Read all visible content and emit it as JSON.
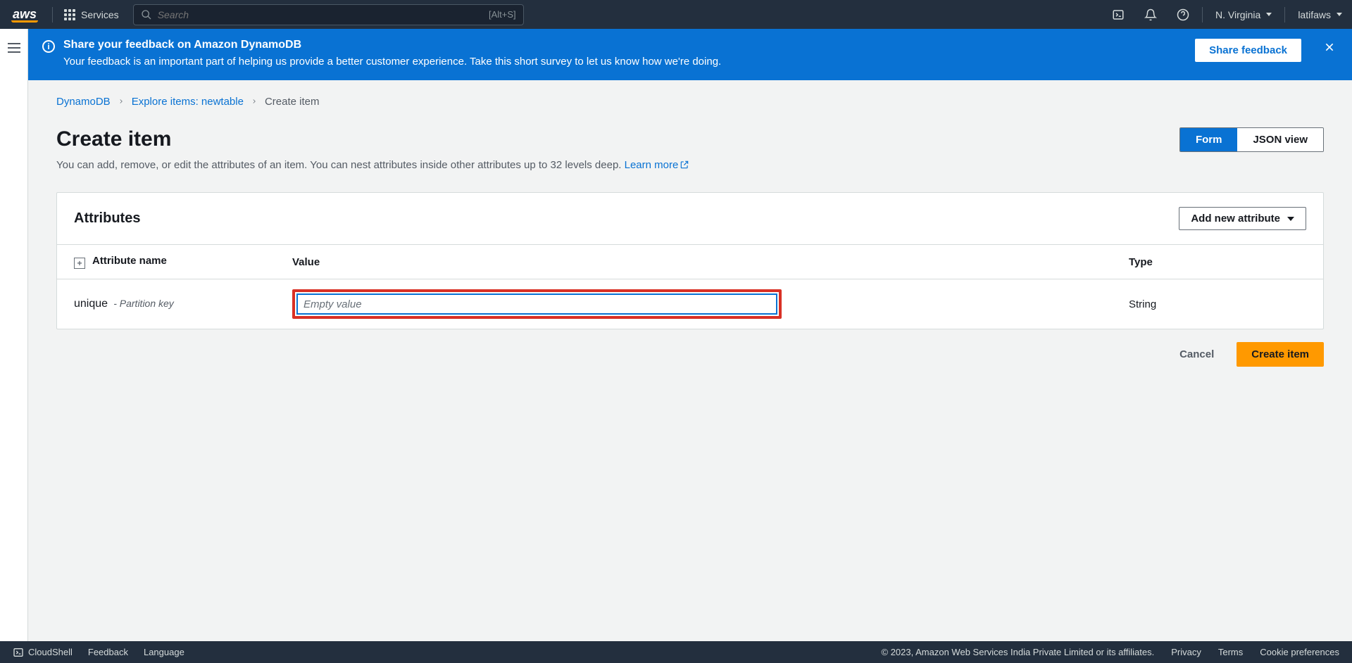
{
  "topnav": {
    "services": "Services",
    "search_placeholder": "Search",
    "search_hint": "[Alt+S]",
    "region": "N. Virginia",
    "user": "latifaws"
  },
  "banner": {
    "title": "Share your feedback on Amazon DynamoDB",
    "desc": "Your feedback is an important part of helping us provide a better customer experience. Take this short survey to let us know how we're doing.",
    "button": "Share feedback"
  },
  "breadcrumb": {
    "items": [
      "DynamoDB",
      "Explore items: newtable",
      "Create item"
    ]
  },
  "header": {
    "title": "Create item",
    "desc_pre": "You can add, remove, or edit the attributes of an item. You can nest attributes inside other attributes up to 32 levels deep. ",
    "learn_more": "Learn more",
    "toggle": {
      "form": "Form",
      "json": "JSON view"
    }
  },
  "panel": {
    "title": "Attributes",
    "add_btn": "Add new attribute",
    "columns": {
      "name": "Attribute name",
      "value": "Value",
      "type": "Type"
    },
    "rows": [
      {
        "name": "unique",
        "hint": "- Partition key",
        "placeholder": "Empty value",
        "value": "",
        "type": "String"
      }
    ]
  },
  "actions": {
    "cancel": "Cancel",
    "create": "Create item"
  },
  "footer": {
    "cloudshell": "CloudShell",
    "feedback": "Feedback",
    "language": "Language",
    "copyright": "© 2023, Amazon Web Services India Private Limited or its affiliates.",
    "privacy": "Privacy",
    "terms": "Terms",
    "cookies": "Cookie preferences"
  }
}
